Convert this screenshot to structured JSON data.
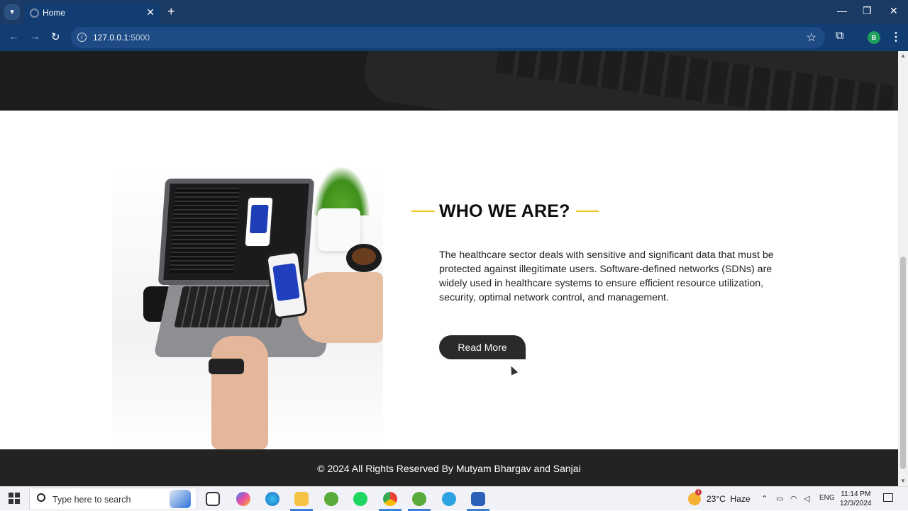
{
  "browser": {
    "tab_title": "Home",
    "url_host": "127.0.0.1",
    "url_port": ":5000",
    "profile_initial": "B"
  },
  "section": {
    "title": "WHO WE ARE?",
    "description": "The healthcare sector deals with sensitive and significant data that must be protected against illegitimate users. Software-defined networks (SDNs) are widely used in healthcare systems to ensure efficient resource utilization, security, optimal network control, and management.",
    "button_label": "Read More"
  },
  "footer": {
    "text": "© 2024 All Rights Reserved By Mutyam Bhargav and Sanjai"
  },
  "taskbar": {
    "search_placeholder": "Type here to search",
    "weather_temp": "23°C",
    "weather_condition": "Haze",
    "weather_badge": "1",
    "language": "ENG",
    "time": "11:14 PM",
    "date": "12/3/2024"
  },
  "colors": {
    "browser_frame": "#1b3a64",
    "accent_line": "#f3c522",
    "button_bg": "#2a2a2a",
    "footer_bg": "#232323"
  }
}
